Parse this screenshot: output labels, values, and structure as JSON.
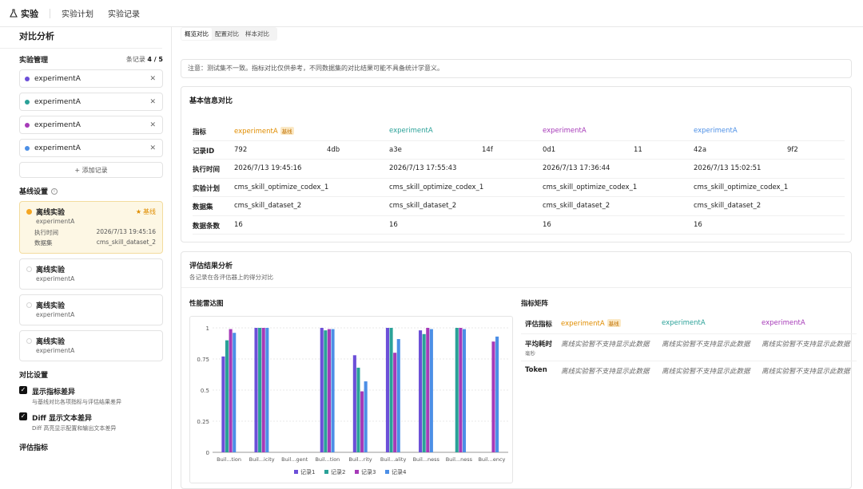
{
  "topbar": {
    "brand": "实验",
    "nav": [
      "实验计划",
      "实验记录"
    ]
  },
  "sidebar": {
    "title": "对比分析",
    "mgmt_title": "实验管理",
    "count_label": "条记录",
    "count_value": "4 / 5",
    "experiments": [
      {
        "name": "experimentA",
        "color": "#6c4fd8"
      },
      {
        "name": "experimentA",
        "color": "#2aa198"
      },
      {
        "name": "experimentA",
        "color": "#a63ab8"
      },
      {
        "name": "experimentA",
        "color": "#4c8fe6"
      }
    ],
    "add_label": "+ 添加记录",
    "baseline_title": "基线设置",
    "baseline_cards": [
      {
        "name": "离线实验",
        "sub": "experimentA",
        "badge": "基线",
        "time_label": "执行时间",
        "time": "2026/7/13 19:45:16",
        "ds_label": "数据集",
        "ds": "cms_skill_dataset_2"
      },
      {
        "name": "离线实验",
        "sub": "experimentA"
      },
      {
        "name": "离线实验",
        "sub": "experimentA"
      },
      {
        "name": "离线实验",
        "sub": "experimentA"
      }
    ],
    "compare_title": "对比设置",
    "opt1_title": "显示指标差异",
    "opt1_desc": "与基线对比各项指标与评估结果差异",
    "opt2_title": "Diff 显示文本差异",
    "opt2_desc": "Diff 高亮显示配置和输出文本差异",
    "eval_title": "评估指标"
  },
  "main": {
    "tabs": [
      "概览对比",
      "配置对比",
      "样本对比"
    ],
    "note": "注意：测试集不一致。指标对比仅供参考，不同数据集的对比结果可能不具备统计学意义。",
    "basic_title": "基本信息对比",
    "basic_rows": [
      [
        "指标",
        "experimentA",
        "experimentA",
        "experimentA",
        "experimentA"
      ],
      [
        "记录ID",
        "792",
        "a3e",
        "0d1",
        "42a"
      ],
      [
        "执行时间",
        "2026/7/13 19:45:16",
        "2026/7/13 17:55:43",
        "2026/7/13 17:36:44",
        "2026/7/13 15:02:51"
      ],
      [
        "实验计划",
        "cms_skill_optimize_codex_1",
        "cms_skill_optimize_codex_1",
        "cms_skill_optimize_codex_1",
        "cms_skill_optimize_codex_1"
      ],
      [
        "数据集",
        "cms_skill_dataset_2",
        "cms_skill_dataset_2",
        "cms_skill_dataset_2",
        "cms_skill_dataset_2"
      ],
      [
        "数据条数",
        "16",
        "16",
        "16",
        "16"
      ]
    ],
    "id_tails": [
      "4db",
      "14f",
      "11",
      "9f2"
    ],
    "baseline_pill": "基线",
    "eval_title": "评估结果分析",
    "eval_sub": "各记录在各评估器上的得分对比",
    "chart_title": "性能雷达图",
    "matrix_title": "指标矩阵",
    "matrix_head": [
      "评估指标",
      "experimentA",
      "experimentA",
      "experimentA"
    ],
    "matrix_rows": [
      {
        "name": "平均耗时",
        "unit": "毫秒",
        "vals": [
          "离线实验暂不支持显示此数据",
          "离线实验暂不支持显示此数据",
          "离线实验暂不支持显示此数据"
        ]
      },
      {
        "name": "Token",
        "vals": [
          "离线实验暂不支持显示此数据",
          "离线实验暂不支持显示此数据",
          "离线实验暂不支持显示此数据"
        ]
      }
    ]
  },
  "colors": {
    "s1": "#6c4fd8",
    "s2": "#2aa198",
    "s3": "#a63ab8",
    "s4": "#4c8fe6",
    "accent": "#f5a623"
  },
  "chart_data": {
    "type": "bar",
    "categories": [
      "Buil...tion",
      "Buil...icity",
      "Buil...gent",
      "Buil...tion",
      "Buil...rity",
      "Buil...ality",
      "Buil...ness",
      "Buil...ness",
      "Buil...ency"
    ],
    "series": [
      {
        "name": "记录1",
        "values": [
          0.77,
          1,
          null,
          1,
          0.78,
          1,
          0.98,
          null,
          null
        ]
      },
      {
        "name": "记录2",
        "values": [
          0.9,
          1,
          null,
          0.98,
          0.68,
          1,
          0.95,
          1,
          null
        ]
      },
      {
        "name": "记录3",
        "values": [
          0.99,
          1,
          null,
          0.99,
          0.49,
          0.8,
          1,
          1,
          0.89
        ]
      },
      {
        "name": "记录4",
        "values": [
          0.96,
          1,
          null,
          0.99,
          0.57,
          0.91,
          0.99,
          0.99,
          0.93
        ]
      }
    ],
    "ylim": [
      0,
      1
    ],
    "yticks": [
      "0",
      "0.25",
      "0.5",
      "0.75",
      "1"
    ],
    "legend": "bottom"
  }
}
